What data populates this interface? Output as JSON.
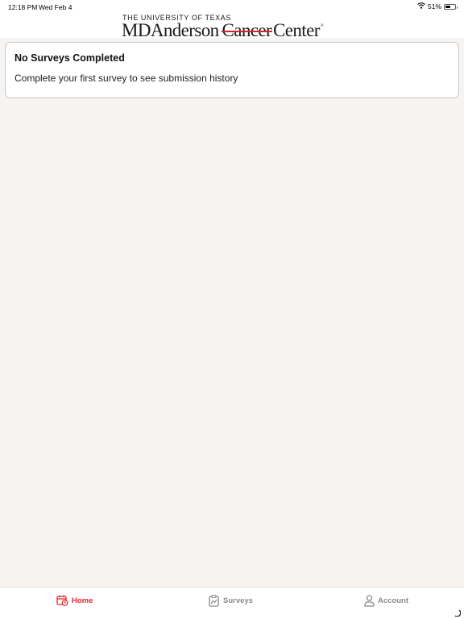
{
  "status_bar": {
    "time": "12:18 PM",
    "date": "Wed Feb 4",
    "battery": "51%",
    "battery_level": 0.51
  },
  "header": {
    "logo_top": "THE UNIVERSITY OF TEXAS",
    "logo_main_md": "MD",
    "logo_main_anderson": "Anderson",
    "logo_main_cancer": "Cancer",
    "logo_main_center": "Center",
    "logo_registered": "®"
  },
  "card": {
    "title": "No Surveys Completed",
    "text": "Complete your first survey to see submission history"
  },
  "tabs": [
    {
      "label": "Home",
      "icon": "calendar-icon",
      "active": true
    },
    {
      "label": "Surveys",
      "icon": "chart-clipboard-icon",
      "active": false
    },
    {
      "label": "Account",
      "icon": "person-icon",
      "active": false
    }
  ],
  "colors": {
    "accent": "#e3262c",
    "background": "#f6f3f1",
    "inactive": "#8a8a8a"
  }
}
